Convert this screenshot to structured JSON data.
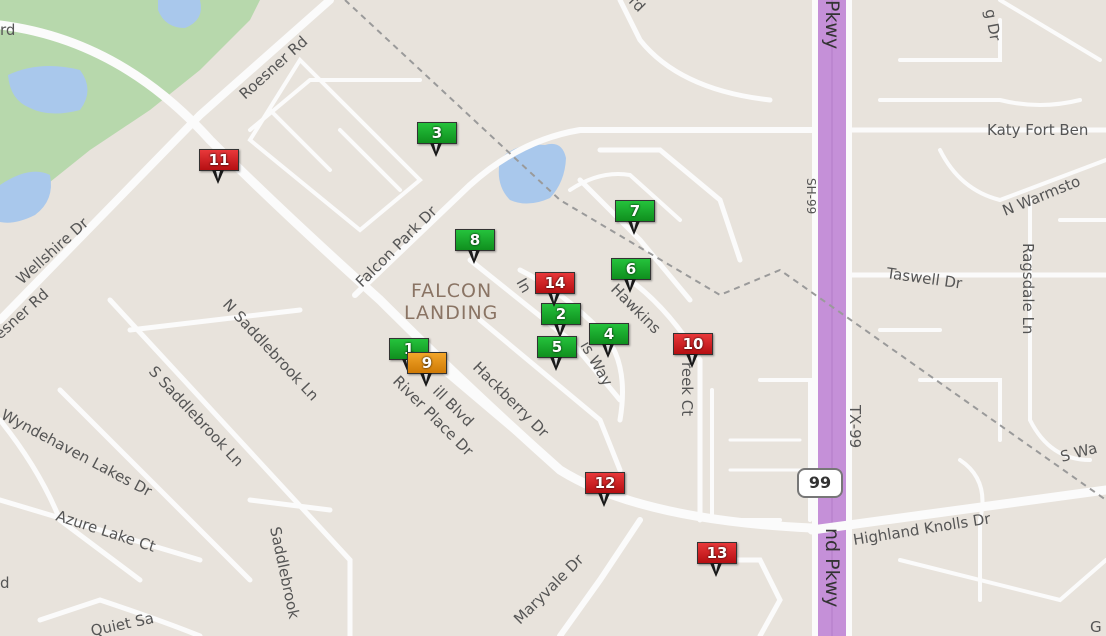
{
  "map": {
    "area_label_line1": "FALCON",
    "area_label_line2": "LANDING",
    "highway_shield": "99",
    "street_labels": {
      "roesner_rd": "Roesner Rd",
      "wellshire_dr": "Wellshire Dr",
      "esner_rd": "esner Rd",
      "falcon_park_dr": "Falcon Park Dr",
      "n_saddlebrook_ln": "N Saddlebrook Ln",
      "s_saddlebrook_ln": "S Saddlebrook Ln",
      "wyndehaven_lakes_dr": "Wyndehaven Lakes Dr",
      "azure_lake_ct": "Azure Lake Ct",
      "saddlebrook": "Saddlebrook",
      "quiet_sa": "Quiet Sa",
      "hackberry_dr": "Hackberry Dr",
      "river_place_dr": "River Place Dr",
      "ill_blvd": "ill Blvd",
      "maryvale_dr": "Maryvale Dr",
      "in": "In",
      "is_way": "is Way",
      "hawkins": "Hawkins",
      "reek_ct": "reek Ct",
      "sh99": "SH-99",
      "tx99": "TX-99",
      "pkwy_top": "Pkwy",
      "pkwy_bottom": "nd Pkwy",
      "katy_fort_ben": "Katy Fort Ben",
      "n_warmsto": "N Warmsto",
      "taswell_dr": "Taswell Dr",
      "ragsdale_ln": "Ragsdale Ln",
      "highland_knolls_dr": "Highland Knolls Dr",
      "s_wa": "S Wa",
      "g_dr": "g Dr",
      "rd_top": "rd",
      "rd_left": "rd",
      "d_small": "d",
      "g_bottom": "G"
    }
  },
  "markers": [
    {
      "label": "1",
      "color": "green"
    },
    {
      "label": "2",
      "color": "green"
    },
    {
      "label": "3",
      "color": "green"
    },
    {
      "label": "4",
      "color": "green"
    },
    {
      "label": "5",
      "color": "green"
    },
    {
      "label": "6",
      "color": "green"
    },
    {
      "label": "7",
      "color": "green"
    },
    {
      "label": "8",
      "color": "green"
    },
    {
      "label": "9",
      "color": "orange"
    },
    {
      "label": "10",
      "color": "red"
    },
    {
      "label": "11",
      "color": "red"
    },
    {
      "label": "12",
      "color": "red"
    },
    {
      "label": "13",
      "color": "red"
    },
    {
      "label": "14",
      "color": "red"
    }
  ]
}
